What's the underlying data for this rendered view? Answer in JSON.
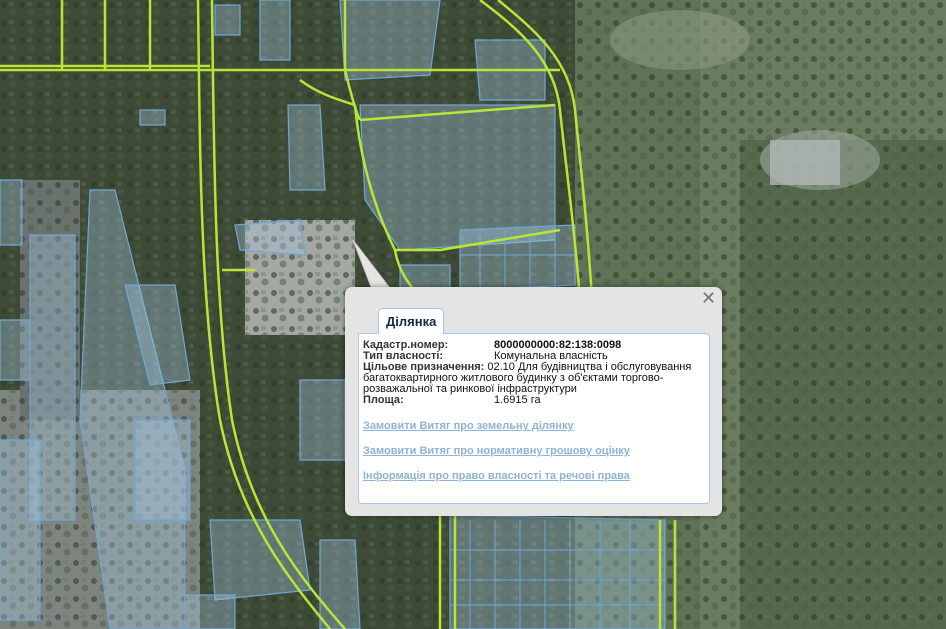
{
  "popup": {
    "close_label": "✕",
    "tab_label": "Ділянка",
    "fields": {
      "cadastral_label": "Кадастр.номер:",
      "cadastral_value": "8000000000:82:138:0098",
      "ownership_label": "Тип власності:",
      "ownership_value": "Комунальна власність",
      "purpose_label": "Цільове призначення:",
      "purpose_value": "02.10 Для будівництва і обслуговування багатоквартирного житлового будинку з об'єктами торгово-розважальної та ринкової інфраструктури",
      "area_label": "Площа:",
      "area_value": "1.6915 га"
    },
    "links": [
      "Замовити Витяг про земельну ділянку",
      "Замовити Витяг про нормативну грошову оцінку",
      "Інформація про право власності та речові права"
    ]
  },
  "colors": {
    "road": "#b8e636",
    "parcel_fill": "#a9cbe8",
    "parcel_stroke": "#6fa6d6",
    "link": "#8fb3d6"
  }
}
